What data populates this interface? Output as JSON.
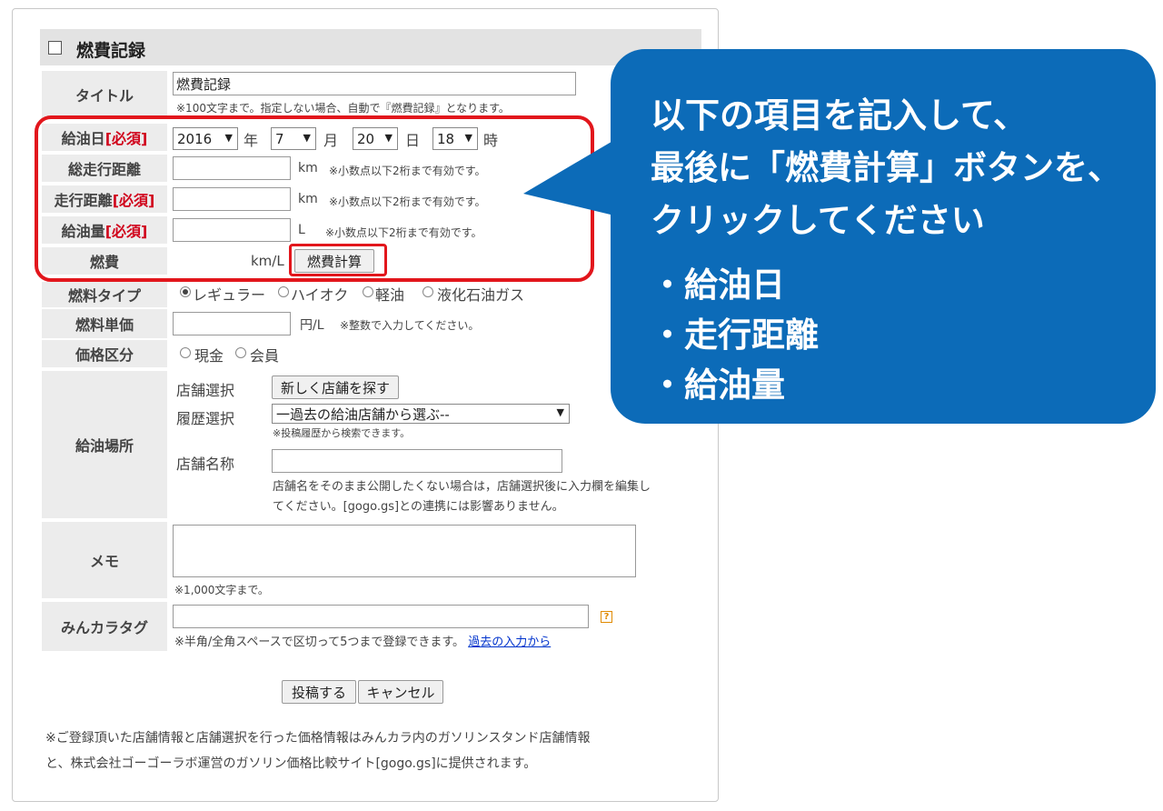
{
  "section": {
    "title": "燃費記録"
  },
  "rows": {
    "title": {
      "label": "タイトル",
      "value": "燃費記録",
      "note": "※100文字まで。指定しない場合、自動で『燃費記録』となります。"
    },
    "refuel_date": {
      "label": "給油日",
      "required": "[必須]",
      "year": "2016",
      "year_unit": "年",
      "month": "7",
      "month_unit": "月",
      "day": "20",
      "day_unit": "日",
      "hour": "18",
      "hour_unit": "時"
    },
    "odometer": {
      "label": "総走行距離",
      "unit": "km",
      "note": "※小数点以下2桁まで有効です。"
    },
    "distance": {
      "label": "走行距離",
      "required": "[必須]",
      "unit": "km",
      "note": "※小数点以下2桁まで有効です。"
    },
    "fuel_amount": {
      "label": "給油量",
      "required": "[必須]",
      "unit": "L",
      "note": "※小数点以下2桁まで有効です。"
    },
    "fuel_economy": {
      "label": "燃費",
      "unit": "km/L",
      "button": "燃費計算"
    },
    "fuel_type": {
      "label": "燃料タイプ",
      "options": [
        "レギュラー",
        "ハイオク",
        "軽油",
        "液化石油ガス"
      ],
      "selected": "レギュラー"
    },
    "unit_price": {
      "label": "燃料単価",
      "unit": "円/L",
      "note": "※整数で入力してください。"
    },
    "price_class": {
      "label": "価格区分",
      "options": [
        "現金",
        "会員"
      ]
    },
    "refuel_place": {
      "label": "給油場所",
      "store_select_label": "店舗選択",
      "store_search_button": "新しく店舗を探す",
      "history_label": "履歴選択",
      "history_selected": "一過去の給油店舗から選ぶ--",
      "history_note": "※投稿履歴から検索できます。",
      "store_name_label": "店舗名称",
      "store_name_note_1": "店舗名をそのまま公開したくない場合は，店舗選択後に入力欄を編集し",
      "store_name_note_2": "てください。[gogo.gs]との連携には影響ありません。"
    },
    "memo": {
      "label": "メモ",
      "note": "※1,000文字まで。"
    },
    "tags": {
      "label": "みんカラタグ",
      "note": "※半角/全角スペースで区切って5つまで登録できます。",
      "link": "過去の入力から",
      "help_icon": "?"
    }
  },
  "actions": {
    "submit": "投稿する",
    "cancel": "キャンセル"
  },
  "footer": {
    "line1": "※ご登録頂いた店舗情報と店舗選択を行った価格情報はみんカラ内のガソリンスタンド店舗情報",
    "line2": "と、株式会社ゴーゴーラボ運営のガソリン価格比較サイト[gogo.gs]に提供されます。"
  },
  "callout": {
    "line1": "以下の項目を記入して、",
    "line2": "最後に「燃費計算」ボタンを、",
    "line3": "クリックしてください",
    "items": [
      "・給油日",
      "・走行距離",
      "・給油量"
    ]
  },
  "colors": {
    "callout_bg": "#0c6bb8",
    "highlight": "#e2161c",
    "required": "#d0021b"
  }
}
